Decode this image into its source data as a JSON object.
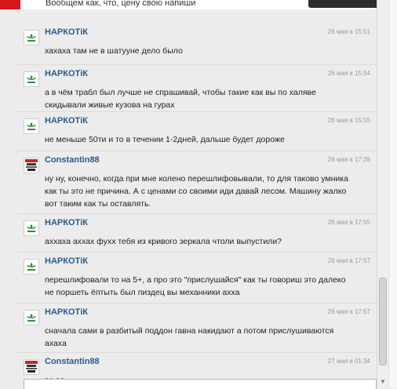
{
  "top_partial_text": "Вообщем как, что, цену свою напиши",
  "messages": [
    {
      "author": "НАРКОТiК",
      "avatar": "adidas-logo-icon",
      "time": "26 мая в 15:51",
      "lines": [
        "хахаха там не в шатууне дело было"
      ]
    },
    {
      "author": "НАРКОТiК",
      "avatar": "adidas-logo-icon",
      "time": "26 мая в 15:54",
      "lines": [
        "а в чём трабл был лучше не спрашивай, чтобы такие как вы по халяве",
        "скидывали живые кузова на гурах"
      ]
    },
    {
      "author": "НАРКОТiК",
      "avatar": "adidas-logo-icon",
      "time": "26 мая в 15:55",
      "lines": [
        "не меньше 50ти и то в течении 1-2дней, дальше будет дороже"
      ]
    },
    {
      "author": "Constantin88",
      "avatar": "poster-avatar-icon",
      "time": "26 мая в 17:28",
      "lines": [
        "ну ну, конечно, когда при мне колено перешлифовывали, то для таково умника",
        "как ты это не причина. А с ценами со своими иди давай лесом. Машину жалко",
        "вот таким как ты оставлять."
      ]
    },
    {
      "author": "НАРКОТiК",
      "avatar": "adidas-logo-icon",
      "time": "26 мая в 17:55",
      "lines": [
        "аххаха аххах фухх тебя из кривого зеркала чтоли выпустили?"
      ]
    },
    {
      "author": "НАРКОТiК",
      "avatar": "adidas-logo-icon",
      "time": "26 мая в 17:57",
      "lines": [
        "перешлифовали то на 5+, а про это \"прислушайся\" как ты говориш это далеко",
        "не поршеть ёптыть был пиздец вы механники ахха"
      ]
    },
    {
      "author": "НАРКОТiК",
      "avatar": "adidas-logo-icon",
      "time": "26 мая в 17:57",
      "lines": [
        "сначала сами в разбитый поддон гавна накидают а потом прислушиваются",
        "ахаха"
      ]
    },
    {
      "author": "Constantin88",
      "avatar": "poster-avatar-icon",
      "time": "27 мая в 01:34",
      "lines": [
        "во во"
      ]
    }
  ],
  "colors": {
    "author": "#2a5a8e",
    "accent_red": "#d8161e",
    "adidas_green": "#3a8a3a"
  }
}
